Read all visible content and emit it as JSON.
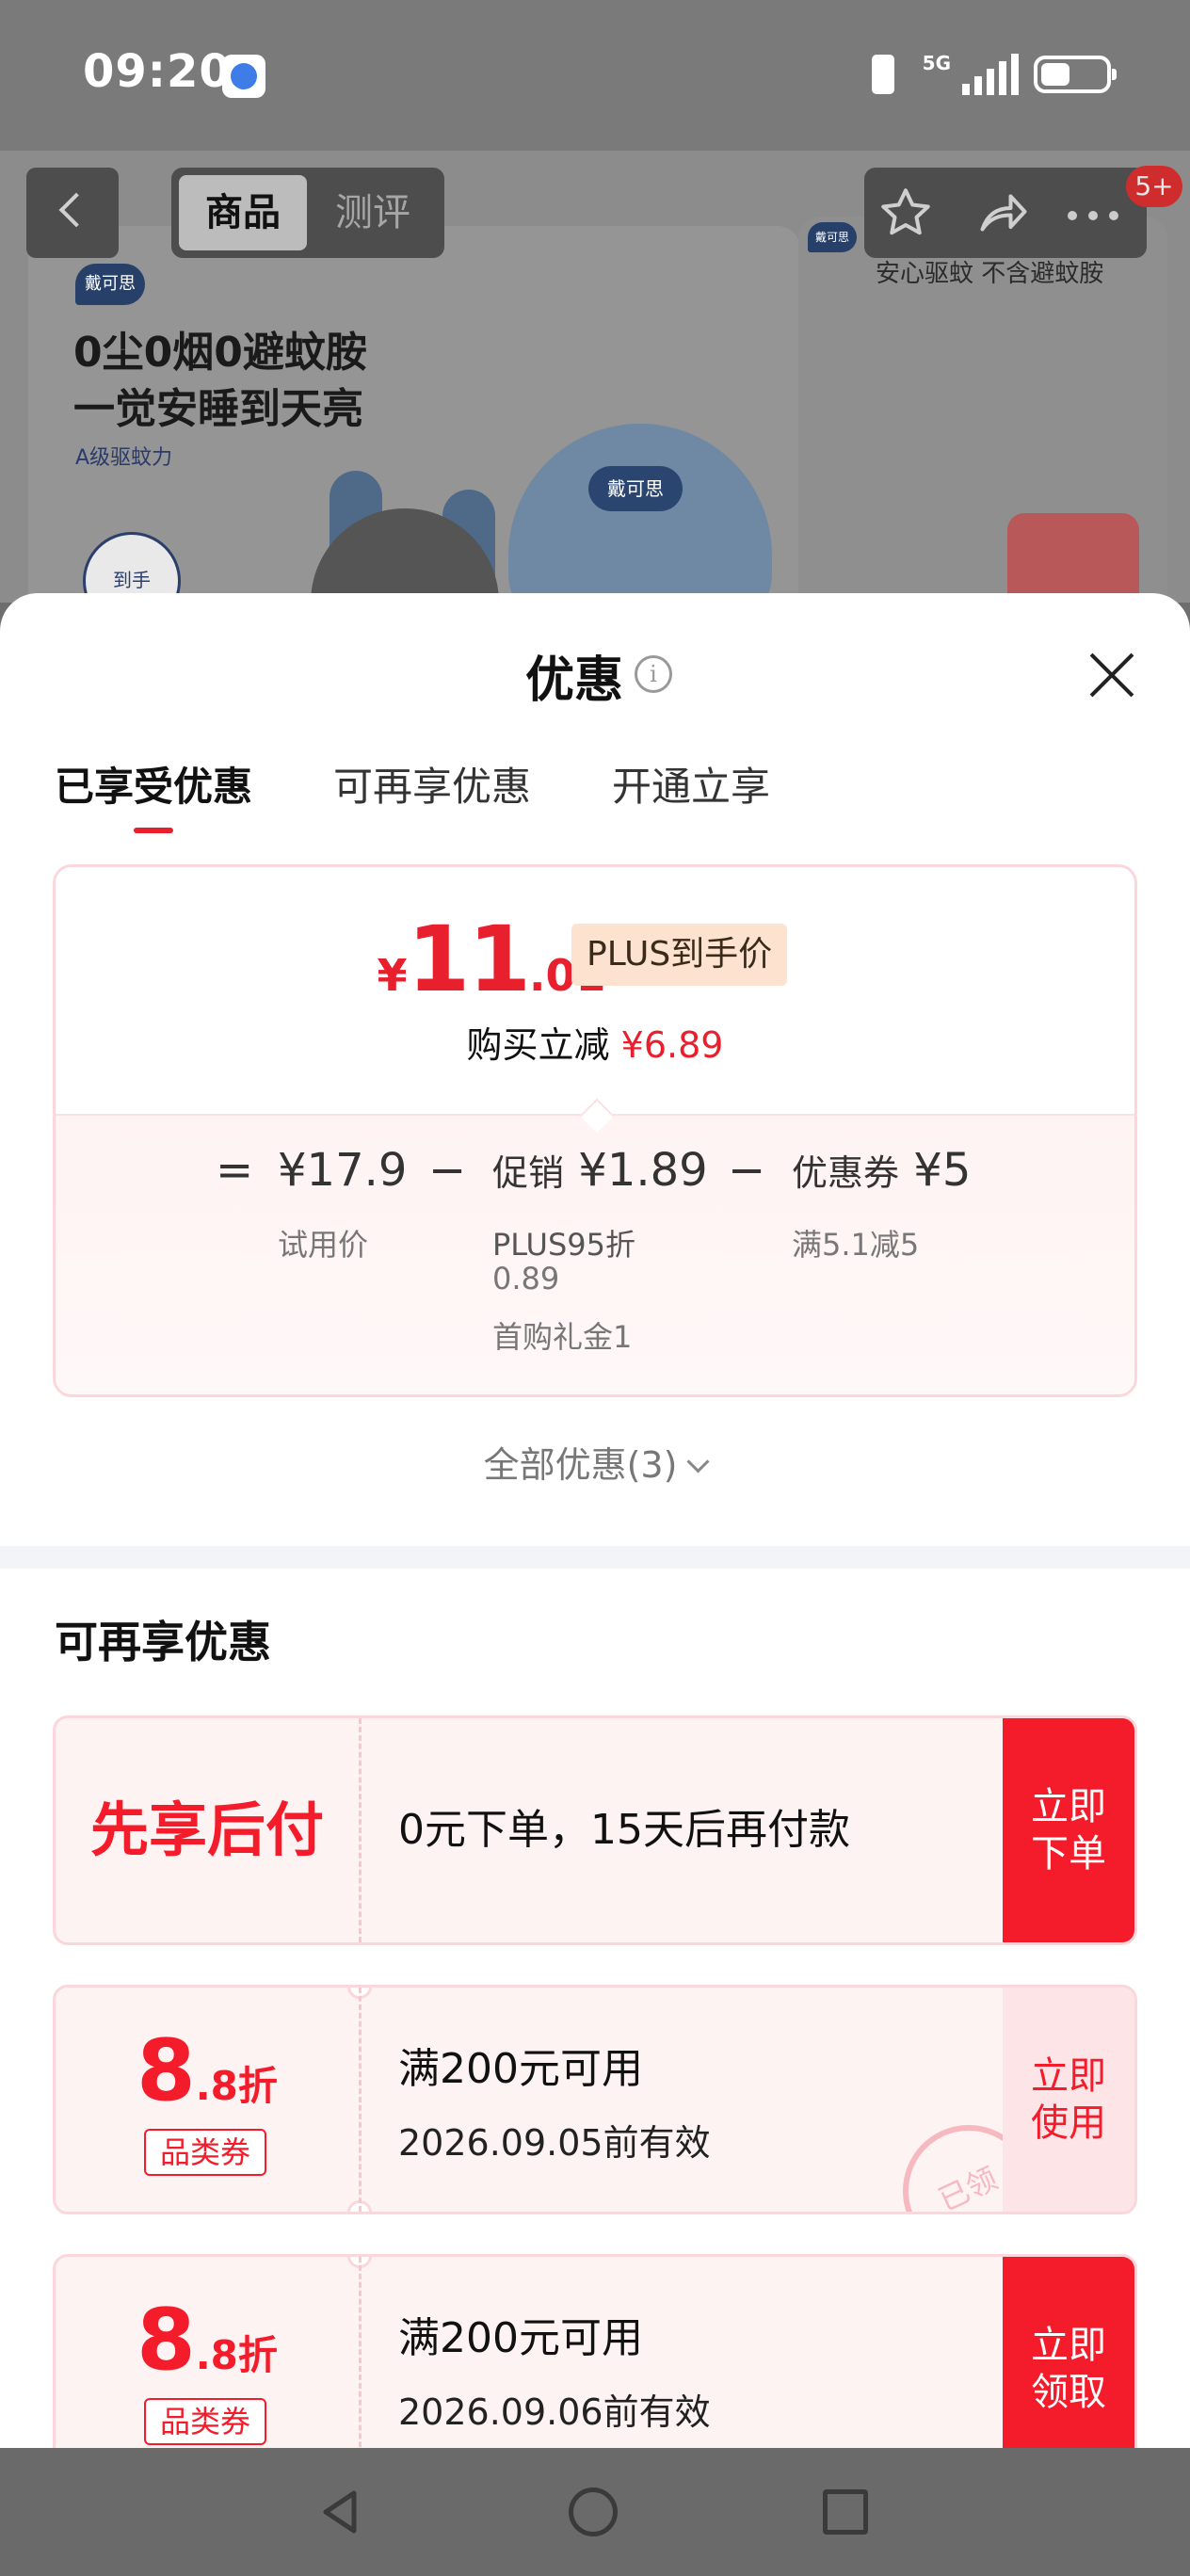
{
  "status_bar": {
    "time": "09:20",
    "network": "5G"
  },
  "product": {
    "brand": "戴可思",
    "headline_line1": "0尘0烟0避蚊胺",
    "headline_line2": "一觉安睡到天亮",
    "sub": "A级驱蚊力",
    "right_text": "安心驱蚊 不含避蚊胺",
    "badge_text": "到手"
  },
  "top_nav": {
    "tab_product": "商品",
    "tab_review": "测评",
    "badge_count": "5+"
  },
  "sheet": {
    "title": "优惠",
    "tabs": [
      "已享受优惠",
      "可再享优惠",
      "开通立享"
    ],
    "price": {
      "currency": "¥",
      "integer": "11",
      "decimal": ".01",
      "tag": "PLUS到手价",
      "discount_label": "购买立减",
      "discount_amount": "¥6.89"
    },
    "formula": {
      "eq": "=",
      "minus": "−",
      "trial_price": "¥17.9",
      "trial_label": "试用价",
      "promo_label": "促销",
      "promo_amount": "¥1.89",
      "promo_sub1": "PLUS95折",
      "promo_sub2": "0.89",
      "promo_sub3": "首购礼金1",
      "coupon_label": "优惠券",
      "coupon_amount": "¥5",
      "coupon_sub": "满5.1减5"
    },
    "all_offers": "全部优惠(3)",
    "section_title": "可再享优惠",
    "coupons": [
      {
        "left_title": "先享后付",
        "desc": "0元下单，15天后再付款",
        "cta": "立即下单"
      },
      {
        "discount_big": "8",
        "discount_small": ".8折",
        "tag": "品类券",
        "condition": "满200元可用",
        "expiry": "2026.09.05前有效",
        "cta": "立即使用",
        "stamp": "已领"
      },
      {
        "discount_big": "8",
        "discount_small": ".8折",
        "tag": "品类券",
        "condition": "满200元可用",
        "expiry": "2026.09.06前有效",
        "cta": "立即领取"
      }
    ]
  }
}
